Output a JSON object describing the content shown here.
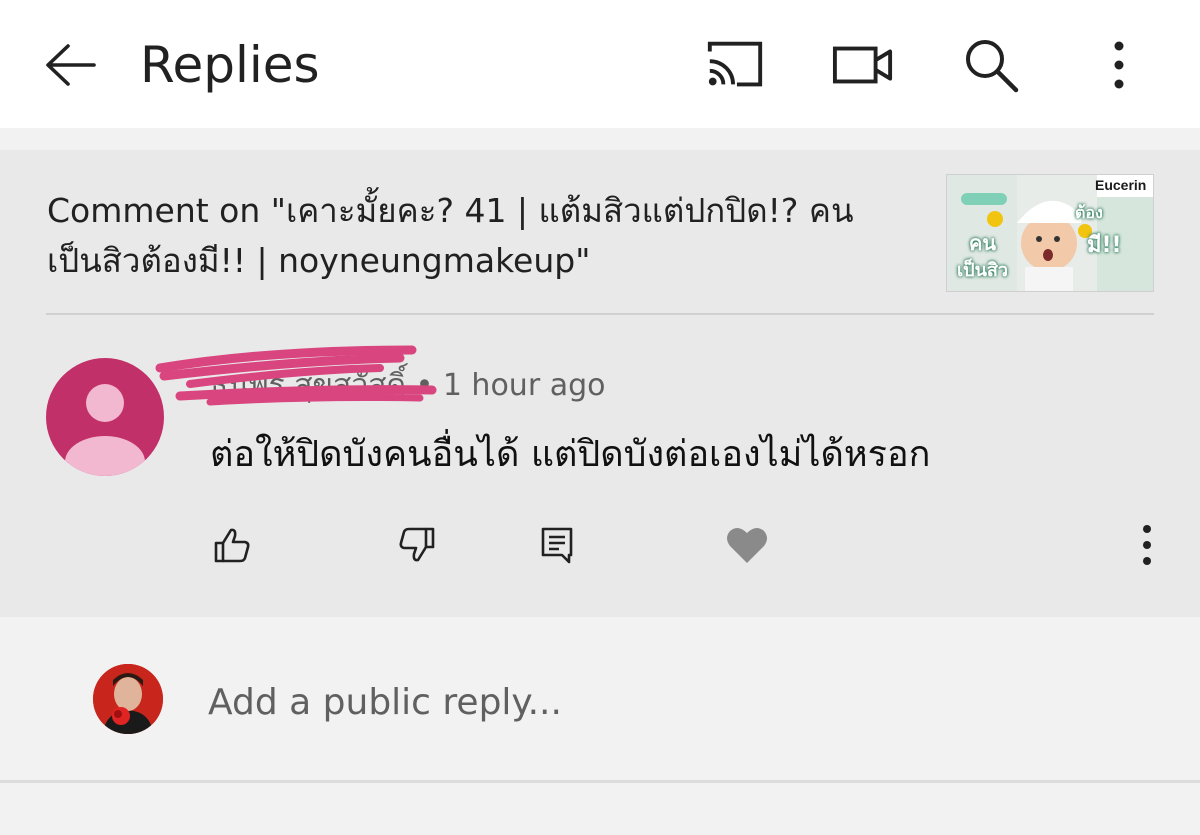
{
  "header": {
    "title": "Replies",
    "icons": [
      "back-arrow-icon",
      "cast-icon",
      "video-camera-icon",
      "search-icon",
      "more-vertical-icon"
    ]
  },
  "context": {
    "text": "Comment on \"เคาะมั้ยคะ? 41 | แต้มสิวแต่ปกปิด!? คน เป็นสิวต้องมี!! | noyneungmakeup\"",
    "thumbnail_brand": "Eucerin",
    "thumbnail_text_1": "ต้อง",
    "thumbnail_text_2": "มี!!",
    "thumbnail_text_3": "คน",
    "thumbnail_text_4": "เป็นสิว"
  },
  "comment": {
    "author": "ธนพร สุขสวัสดิ์",
    "separator": "•",
    "time": "1 hour ago",
    "text": "ต่อให้ปิดบังคนอื่นได้ แต่ปิดบังต่อเองไม่ได้หรอก",
    "actions": [
      "like-icon",
      "dislike-icon",
      "reply-icon",
      "heart-icon",
      "more-vertical-icon"
    ]
  },
  "reply": {
    "placeholder": "Add a public reply..."
  },
  "colors": {
    "avatar": "#c2306a",
    "redaction": "#d9457f",
    "heart": "#8a8a8a"
  }
}
